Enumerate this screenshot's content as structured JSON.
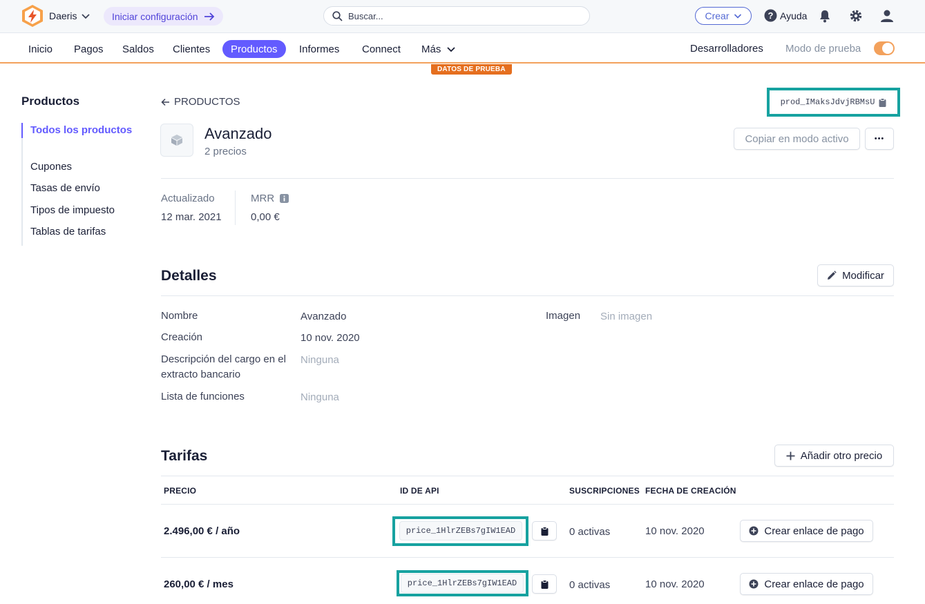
{
  "topbar": {
    "account_name": "Daeris",
    "setup_label": "Iniciar configuración",
    "search_placeholder": "Buscar...",
    "create_label": "Crear",
    "help_label": "Ayuda"
  },
  "nav": {
    "items": [
      "Inicio",
      "Pagos",
      "Saldos",
      "Clientes",
      "Productos",
      "Informes",
      "Connect",
      "Más"
    ],
    "active": "Productos",
    "developers_label": "Desarrolladores",
    "test_mode_label": "Modo de prueba",
    "test_mode_on": true,
    "test_badge": "DATOS DE PRUEBA"
  },
  "sidebar": {
    "title": "Productos",
    "items": [
      "Todos los productos",
      "Cupones",
      "Tasas de envío",
      "Tipos de impuesto",
      "Tablas de tarifas"
    ],
    "active": "Todos los productos"
  },
  "product": {
    "back_label": "PRODUCTOS",
    "id": "prod_IMaksJdvjRBMsU",
    "name": "Avanzado",
    "subtitle": "2 precios",
    "copy_live_label": "Copiar en modo activo",
    "more_label": "•••",
    "updated_label": "Actualizado",
    "updated_value": "12 mar. 2021",
    "mrr_label": "MRR",
    "mrr_value": "0,00 €"
  },
  "details": {
    "title": "Detalles",
    "edit_label": "Modificar",
    "rows": [
      {
        "label": "Nombre",
        "value": "Avanzado"
      },
      {
        "label": "Creación",
        "value": "10 nov. 2020"
      },
      {
        "label": "Descripción del cargo en el extracto bancario",
        "value": "Ninguna"
      },
      {
        "label": "Lista de funciones",
        "value": "Ninguna"
      }
    ],
    "image_label": "Imagen",
    "image_value": "Sin imagen"
  },
  "pricing": {
    "title": "Tarifas",
    "add_label": "Añadir otro precio",
    "headers": [
      "PRECIO",
      "ID DE API",
      "SUSCRIPCIONES",
      "FECHA DE CREACIÓN"
    ],
    "rows": [
      {
        "price": "2.496,00 € / año",
        "api_id": "price_1HlrZEBs7gIW1EAD",
        "subs": "0 activas",
        "created": "10 nov. 2020",
        "action": "Crear enlace de pago"
      },
      {
        "price": "260,00 € / mes",
        "api_id": "price_1HlrZEBs7gIW1EAD",
        "subs": "0 activas",
        "created": "10 nov. 2020",
        "action": "Crear enlace de pago"
      }
    ]
  },
  "colors": {
    "accent": "#635bff",
    "test_orange": "#f3a15c",
    "highlight_teal": "#17a2a0"
  }
}
